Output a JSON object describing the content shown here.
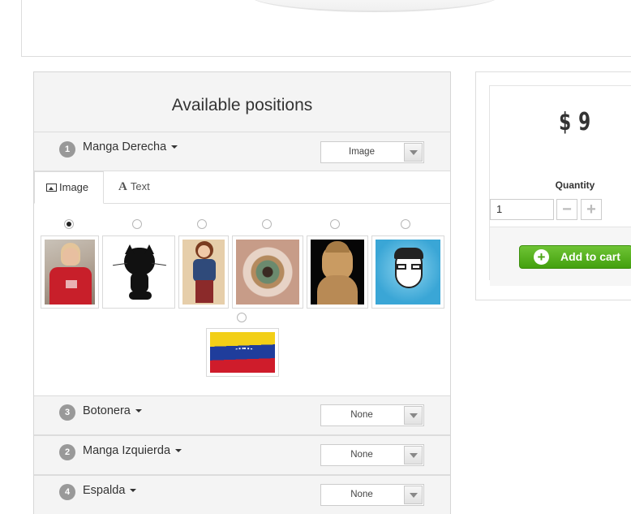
{
  "panel": {
    "title": "Available positions",
    "positions": [
      {
        "number": "1",
        "name": "Manga Derecha",
        "select_value": "Image"
      },
      {
        "number": "3",
        "name": "Botonera",
        "select_value": "None"
      },
      {
        "number": "2",
        "name": "Manga Izquierda",
        "select_value": "None"
      },
      {
        "number": "4",
        "name": "Espalda",
        "select_value": "None"
      }
    ],
    "tabs": [
      {
        "label": "Image",
        "icon": "picture-icon"
      },
      {
        "label": "Text",
        "icon": "text-format-icon"
      }
    ],
    "images": [
      {
        "name": "woman-red-shirt-photo",
        "selected": true
      },
      {
        "name": "github-octocat-logo",
        "selected": false
      },
      {
        "name": "pinup-woman-illustration",
        "selected": false
      },
      {
        "name": "eye-closeup-photo",
        "selected": false
      },
      {
        "name": "buddha-statue-photo",
        "selected": false
      },
      {
        "name": "cartoon-avatar",
        "selected": false
      },
      {
        "name": "venezuela-flag",
        "selected": false
      }
    ]
  },
  "purchase": {
    "price": "$ 9",
    "quantity_label": "Quantity",
    "quantity_value": "1",
    "minus_label": "−",
    "plus_label": "+",
    "add_to_cart_label": "Add to cart"
  },
  "colors": {
    "cart_green": "#4aa512",
    "badge_gray": "#999999",
    "panel_header_bg": "#f4f4f4"
  }
}
